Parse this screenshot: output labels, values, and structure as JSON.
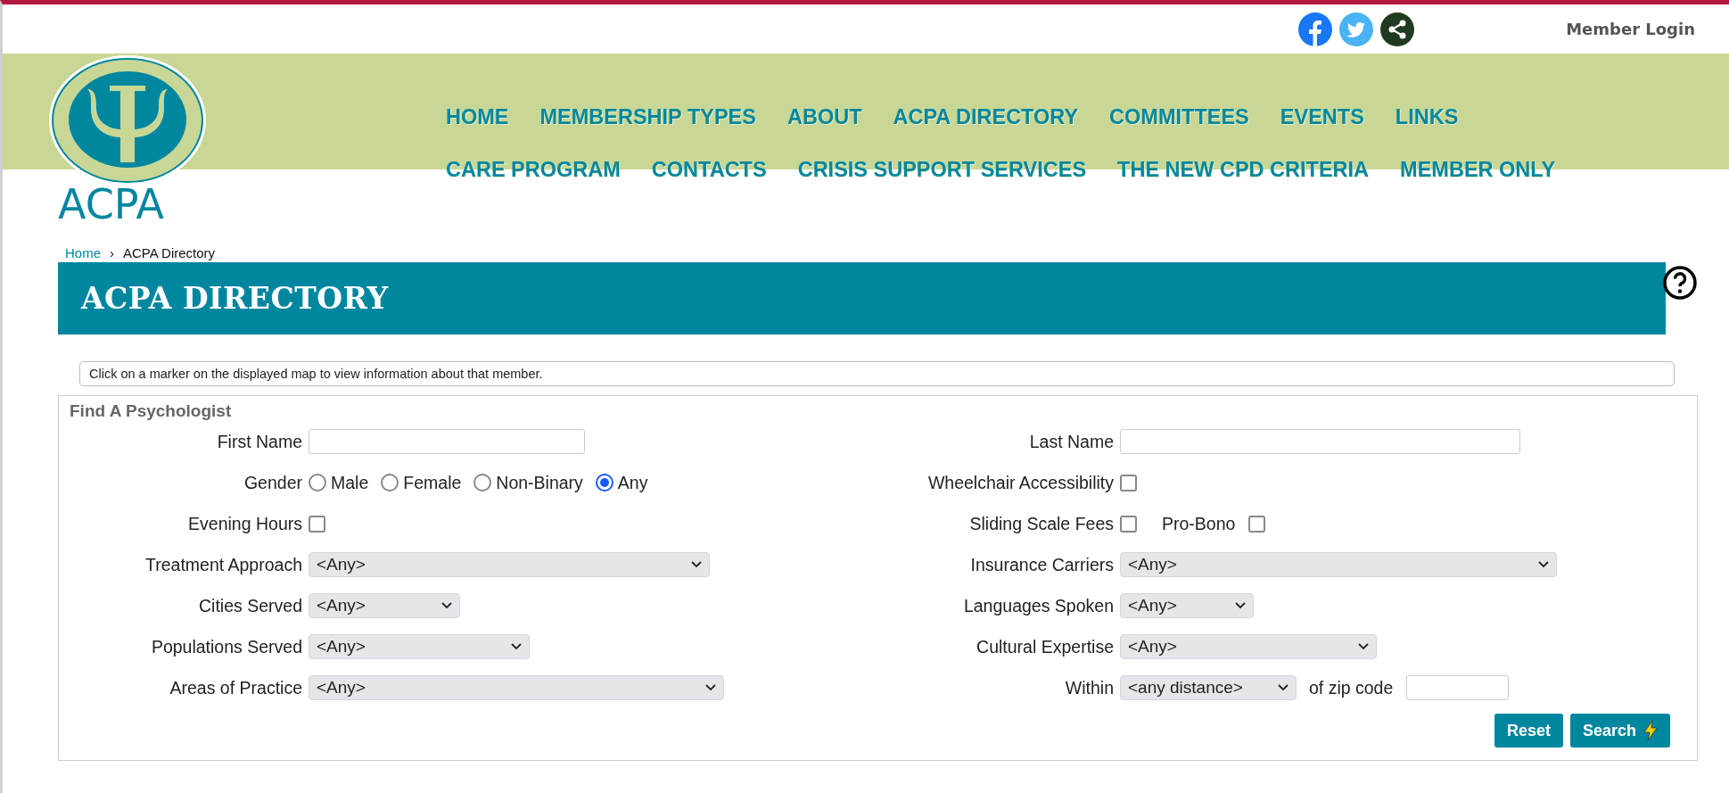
{
  "header": {
    "member_login": "Member Login",
    "logo_text": "ACPA"
  },
  "nav": {
    "items": [
      "HOME",
      "MEMBERSHIP TYPES",
      "ABOUT",
      "ACPA DIRECTORY",
      "COMMITTEES",
      "EVENTS",
      "LINKS",
      "CARE PROGRAM",
      "CONTACTS",
      "CRISIS SUPPORT SERVICES",
      "THE NEW CPD CRITERIA",
      "MEMBER ONLY"
    ]
  },
  "breadcrumb": {
    "home": "Home",
    "separator": "›",
    "current": "ACPA Directory"
  },
  "page_title": "ACPA DIRECTORY",
  "info": "Click on a marker on the displayed map to view information about that member.",
  "form": {
    "legend": "Find A Psychologist",
    "left": [
      {
        "kind": "text",
        "label": "First Name"
      },
      {
        "kind": "radio",
        "label": "Gender",
        "options": [
          {
            "label": "Male",
            "selected": false
          },
          {
            "label": "Female",
            "selected": false
          },
          {
            "label": "Non-Binary",
            "selected": false
          },
          {
            "label": "Any",
            "selected": true
          }
        ]
      },
      {
        "kind": "checkbox",
        "label": "Evening Hours",
        "checked": false
      },
      {
        "kind": "select",
        "label": "Treatment Approach",
        "value": "<Any>"
      },
      {
        "kind": "select",
        "label": "Cities Served",
        "value": "<Any>"
      },
      {
        "kind": "select",
        "label": "Populations Served",
        "value": "<Any>"
      },
      {
        "kind": "select",
        "label": "Areas of Practice",
        "value": "<Any>"
      }
    ],
    "right": [
      {
        "kind": "text",
        "label": "Last Name"
      },
      {
        "kind": "checkbox",
        "label": "Wheelchair Accessibility",
        "checked": false
      },
      {
        "kind": "checkbox_pair",
        "label": "Sliding Scale Fees",
        "checked": false,
        "second": {
          "label": "Pro-Bono",
          "checked": false
        }
      },
      {
        "kind": "select",
        "label": "Insurance Carriers",
        "value": "<Any>"
      },
      {
        "kind": "select",
        "label": "Languages Spoken",
        "value": "<Any>"
      },
      {
        "kind": "select",
        "label": "Cultural Expertise",
        "value": "<Any>"
      },
      {
        "kind": "distance",
        "label": "Within",
        "value": "<any distance>",
        "suffix": "of zip code"
      }
    ],
    "buttons": [
      "Reset",
      "Search"
    ]
  }
}
